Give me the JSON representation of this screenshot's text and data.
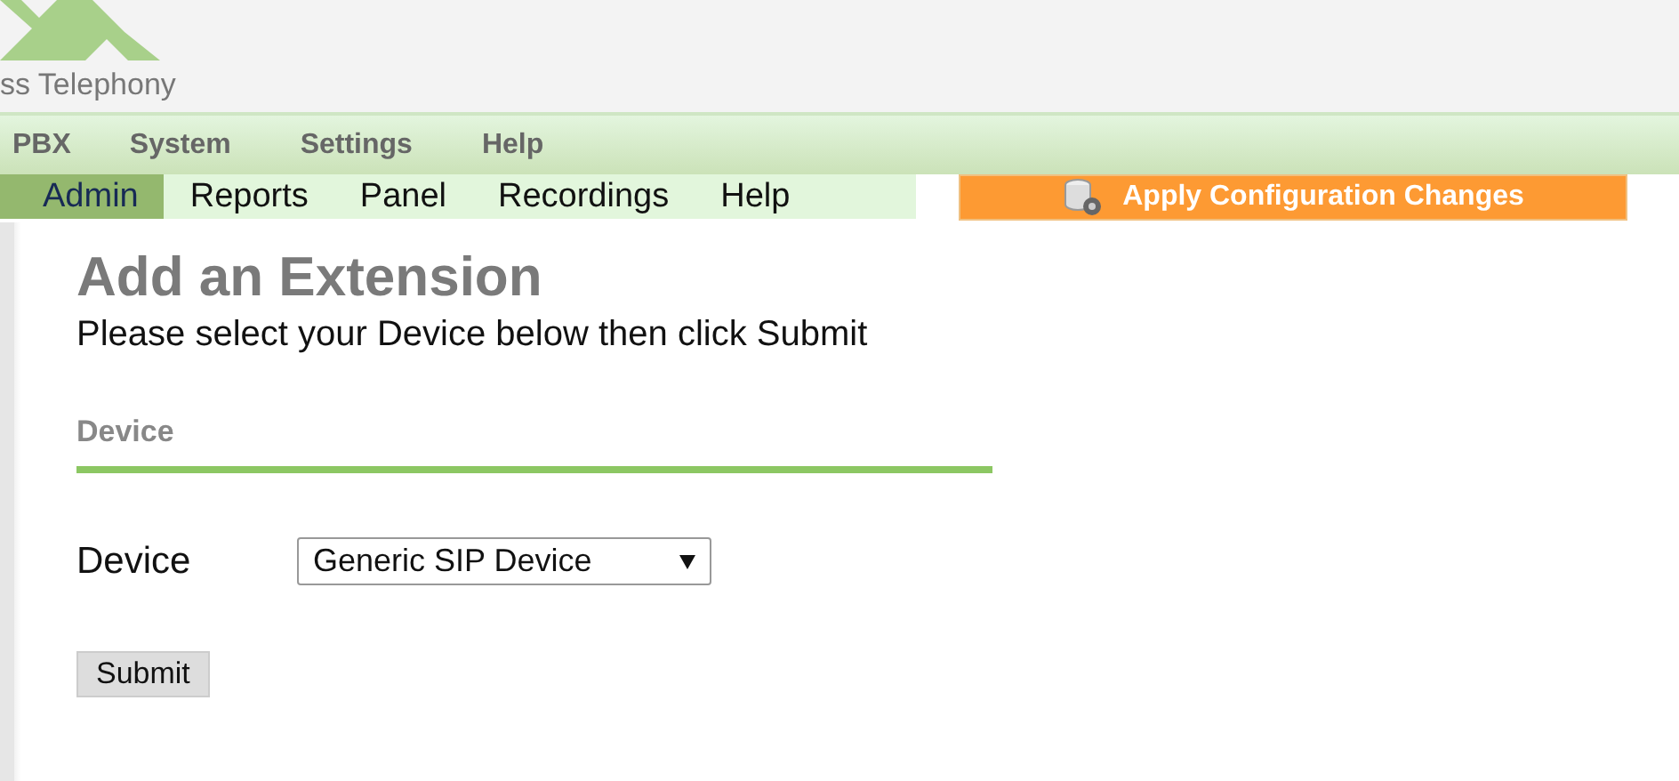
{
  "logo": {
    "text": "ss Telephony"
  },
  "main_menu": [
    {
      "label": "PBX"
    },
    {
      "label": "System"
    },
    {
      "label": "Settings"
    },
    {
      "label": "Help"
    }
  ],
  "tabs": [
    {
      "label": "Admin",
      "selected": true
    },
    {
      "label": "Reports",
      "selected": false
    },
    {
      "label": "Panel",
      "selected": false
    },
    {
      "label": "Recordings",
      "selected": false
    },
    {
      "label": "Help",
      "selected": false
    }
  ],
  "apply_button": {
    "label": "Apply Configuration Changes"
  },
  "page": {
    "title": "Add an Extension",
    "instructions": "Please select your Device below then click Submit",
    "section": "Device",
    "device_field": {
      "label": "Device",
      "value": "Generic SIP Device"
    },
    "submit": "Submit"
  }
}
